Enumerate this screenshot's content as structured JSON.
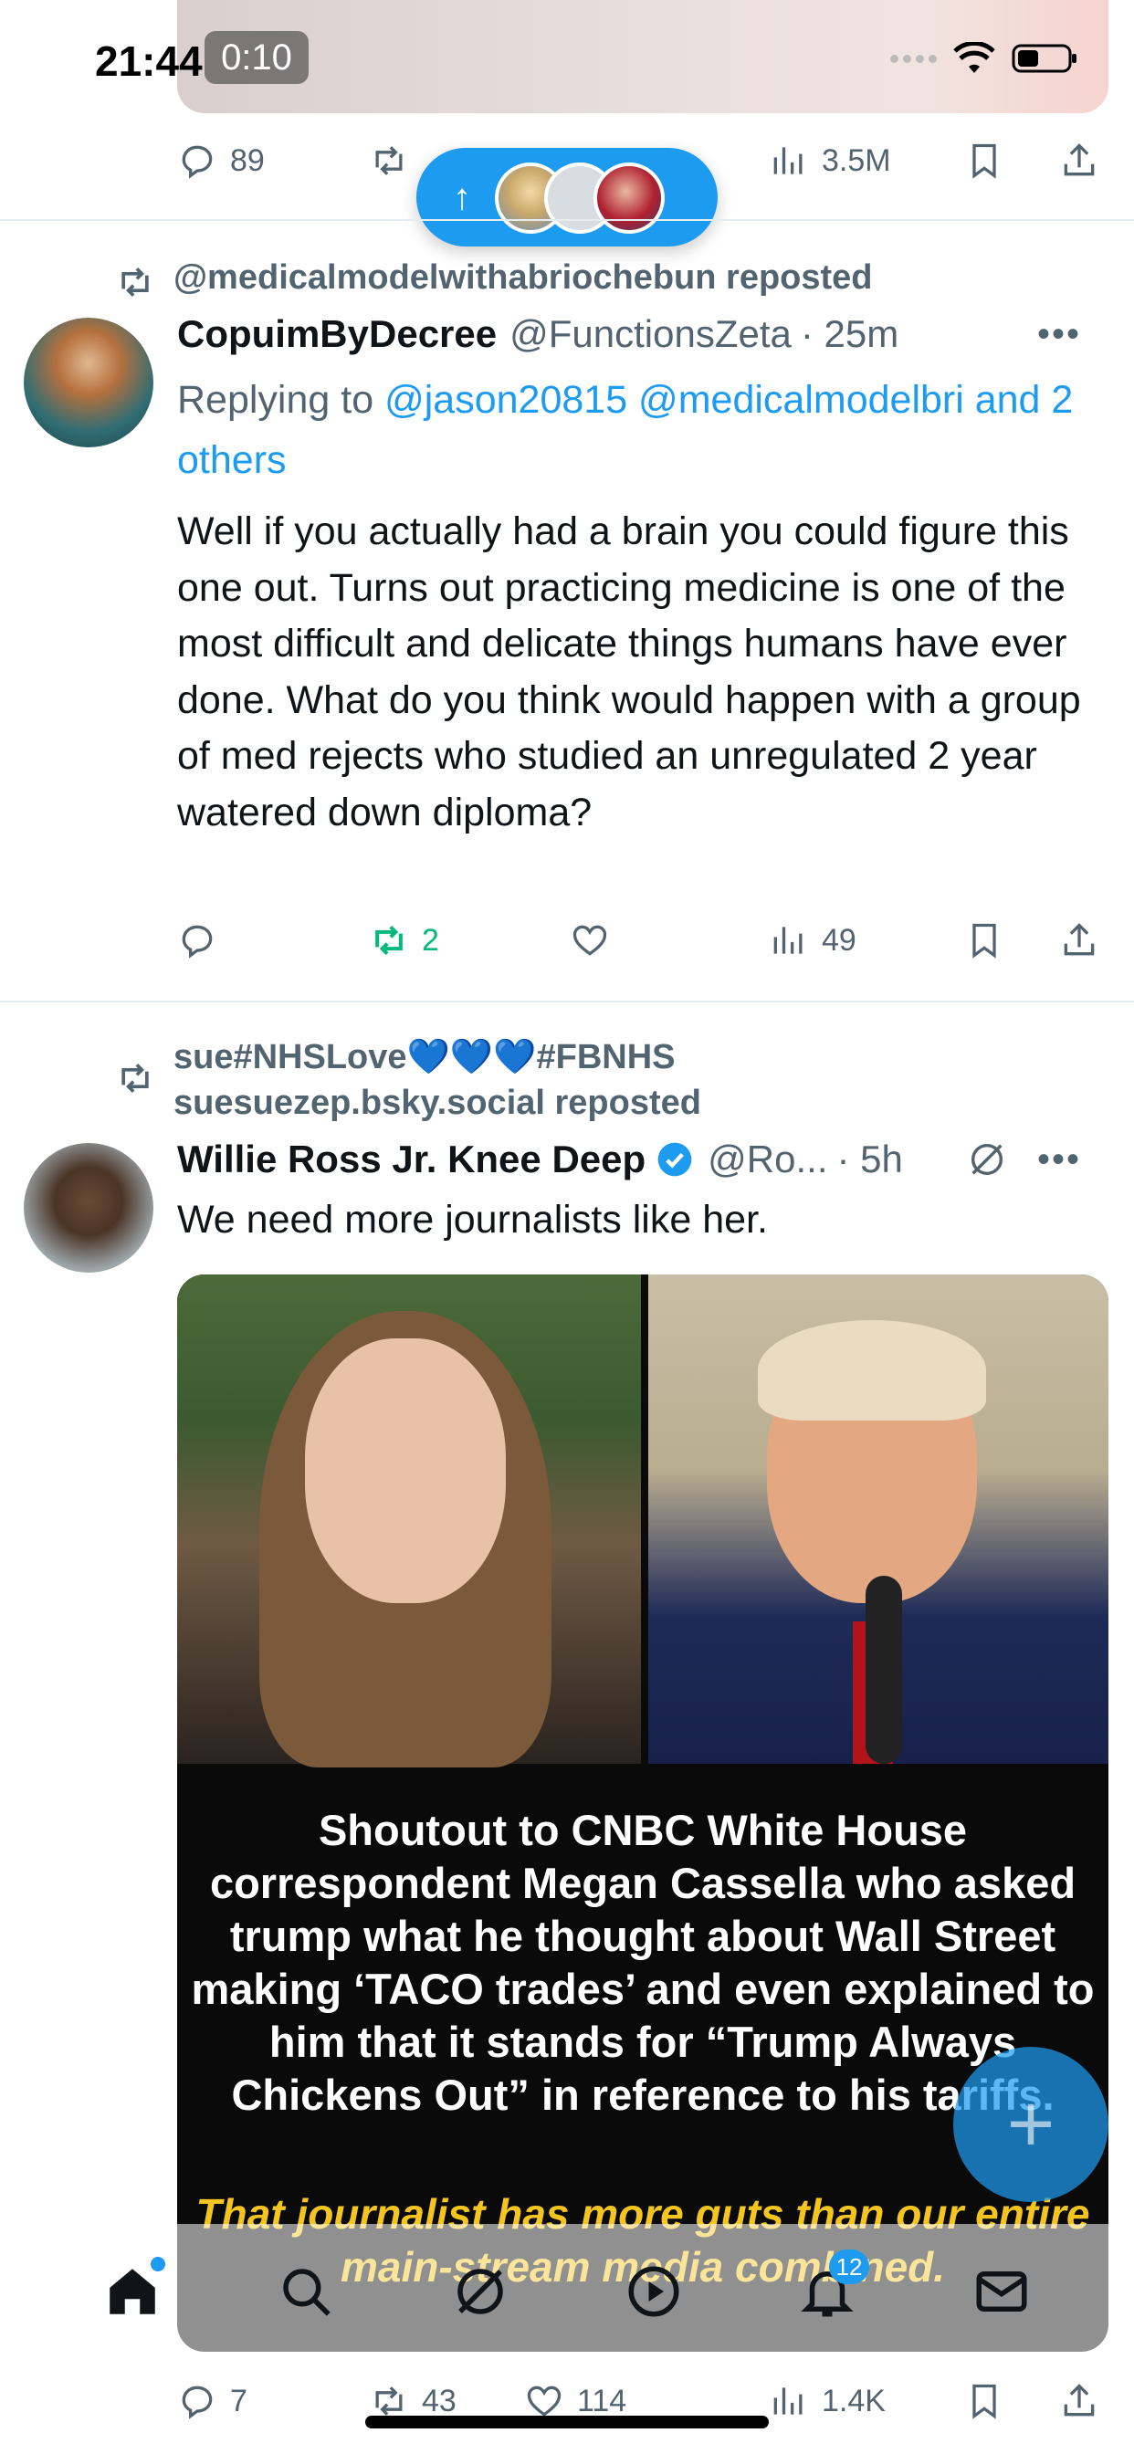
{
  "status_bar": {
    "time": "21:44",
    "timer": "0:10"
  },
  "top_post": {
    "replies": "89",
    "reposts": "",
    "likes": "",
    "views": "3.5M"
  },
  "new_posts_pill": {
    "arrow": "↑"
  },
  "post1": {
    "reposted_by": "@medicalmodelwithabriochebun reposted",
    "author_name": "CopuimByDecree",
    "handle": "@FunctionsZeta",
    "time": "· 25m",
    "replying_prefix": "Replying to",
    "replying_users": "@jason20815 @medicalmodelbri and 2 others",
    "text": "Well if you actually had a brain you could figure this one out. Turns out practicing medicine is one of the most difficult and delicate things humans have ever done. What do you think would happen with a group of med rejects who studied an unregulated 2 year watered down diploma?",
    "replies": "",
    "reposts": "2",
    "likes": "",
    "views": "49"
  },
  "post2": {
    "reposted_by_line1": "sue#NHSLove💙💙💙#FBNHS",
    "reposted_by_line2": "suesuezep.bsky.social reposted",
    "author_name": "Willie Ross Jr. Knee Deep",
    "handle": "@Ro...",
    "time": "· 5h",
    "text": "We need more journalists like her.",
    "caption_white": "Shoutout to CNBC White House correspondent Megan Cassella who asked trump what he thought about Wall Street making ‘TACO trades’ and even explained to him that it stands for “Trump Always Chickens Out” in reference to his tariffs.",
    "caption_yellow": "That journalist has more guts than our entire main-stream media combined.",
    "replies": "7",
    "reposts": "43",
    "likes": "114",
    "views": "1.4K"
  },
  "fab": {
    "label": "+"
  },
  "bottom_nav": {
    "notifications_badge": "12"
  },
  "colors": {
    "accent": "#1d9bf0",
    "repost_green": "#00ba7c",
    "muted": "#536471",
    "caption_yellow": "#f4c51f"
  }
}
